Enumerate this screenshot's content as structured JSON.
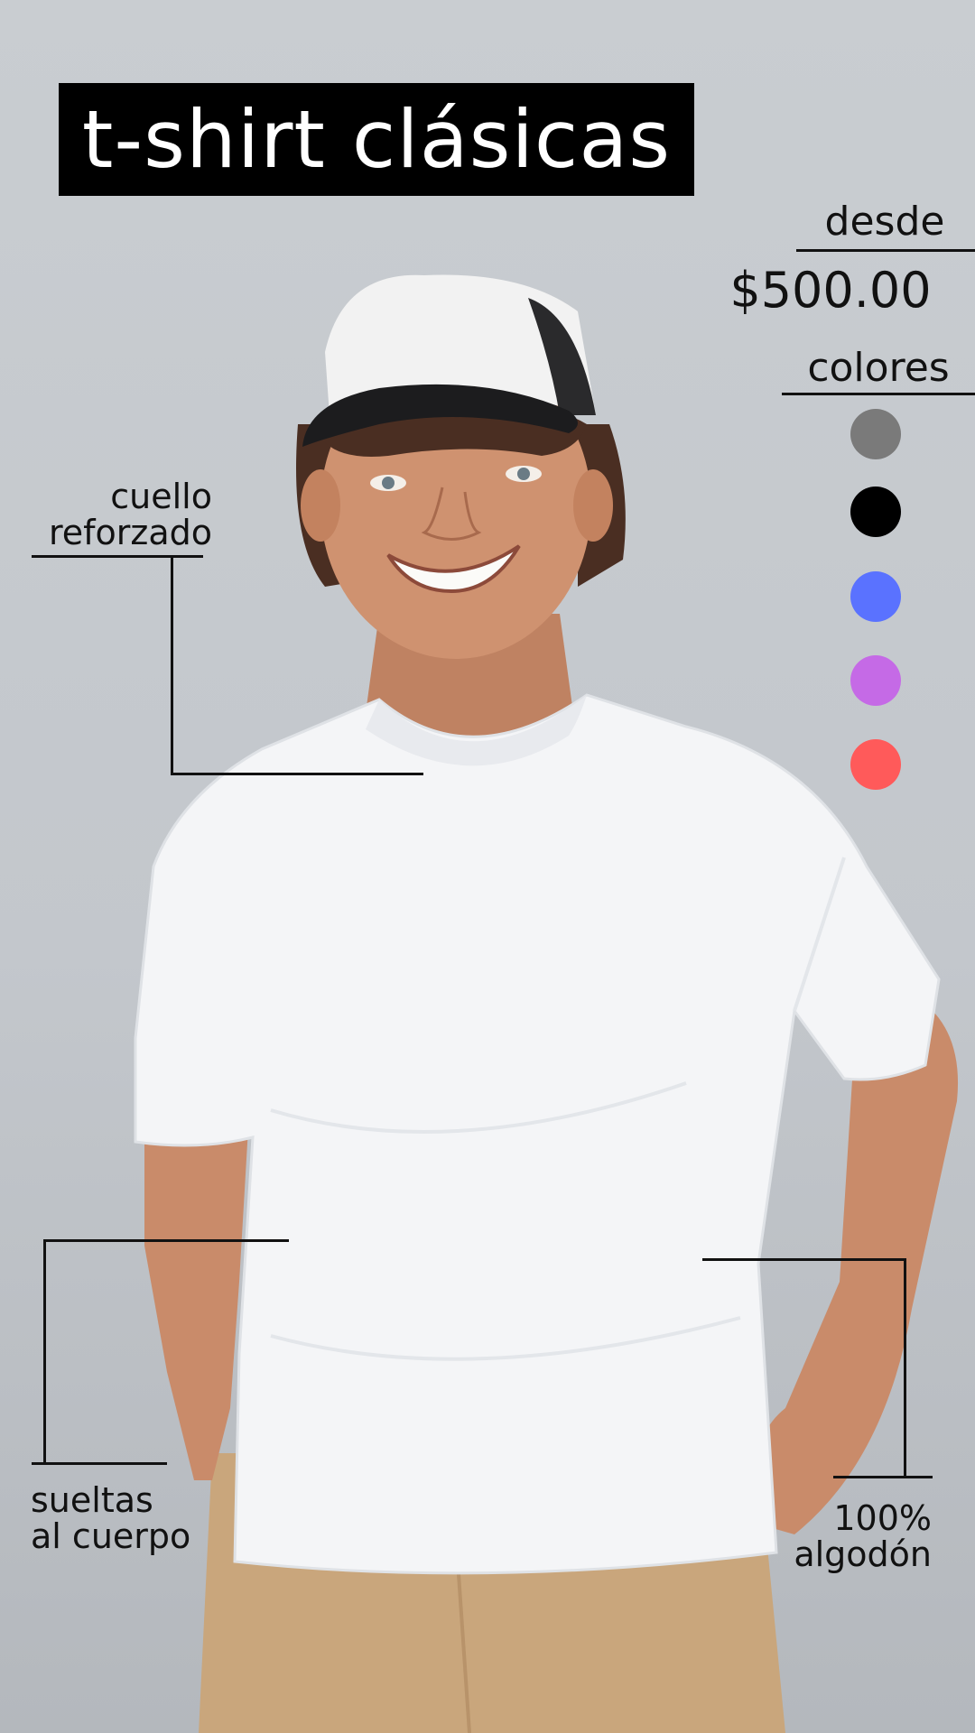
{
  "title": "t-shirt clásicas",
  "price": {
    "from_label": "desde",
    "amount": "$500.00"
  },
  "colors": {
    "label": "colores",
    "swatches": [
      {
        "name": "gris",
        "hex": "#7a7a7a"
      },
      {
        "name": "negro",
        "hex": "#000000"
      },
      {
        "name": "azul",
        "hex": "#5a72ff"
      },
      {
        "name": "morado",
        "hex": "#c56ae6"
      },
      {
        "name": "rojo",
        "hex": "#ff5a5a"
      }
    ]
  },
  "callouts": {
    "collar": {
      "line1": "cuello",
      "line2": "reforzado"
    },
    "fit": {
      "line1": "sueltas",
      "line2": "al cuerpo"
    },
    "material": {
      "line1": "100%",
      "line2": "algodón"
    }
  },
  "palette": {
    "shirt": "#f4f5f7",
    "pants": "#c9a67c",
    "skin": "#c98b6a",
    "hair": "#4a2e22",
    "cap": "#f2f2f2",
    "cap_brim": "#1c1c1e"
  }
}
